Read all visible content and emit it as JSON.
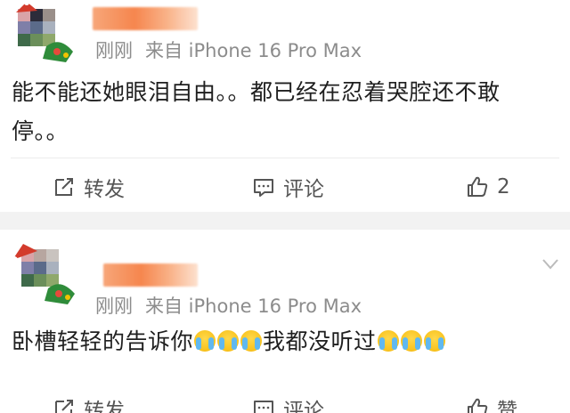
{
  "posts": [
    {
      "time": "刚刚",
      "source": "来自 iPhone 16 Pro Max",
      "text": "能不能还她眼泪自由。。都已经在忍着哭腔还不敢停。。",
      "actions": {
        "forward": "转发",
        "comment": "评论",
        "like_count": "2"
      }
    },
    {
      "time": "刚刚",
      "source": "来自 iPhone 16 Pro Max",
      "text_part1": "卧槽轻轻的告诉你",
      "text_part2": "我都没听过",
      "emoji": "loudly-crying-emoji",
      "actions": {
        "forward": "转发",
        "comment": "评论",
        "like": "赞"
      }
    }
  ],
  "colors": {
    "meta_text": "#8c8c8c",
    "action_text": "#555555",
    "separator": "#f2f2f2",
    "name_blur": "#f6864e"
  }
}
